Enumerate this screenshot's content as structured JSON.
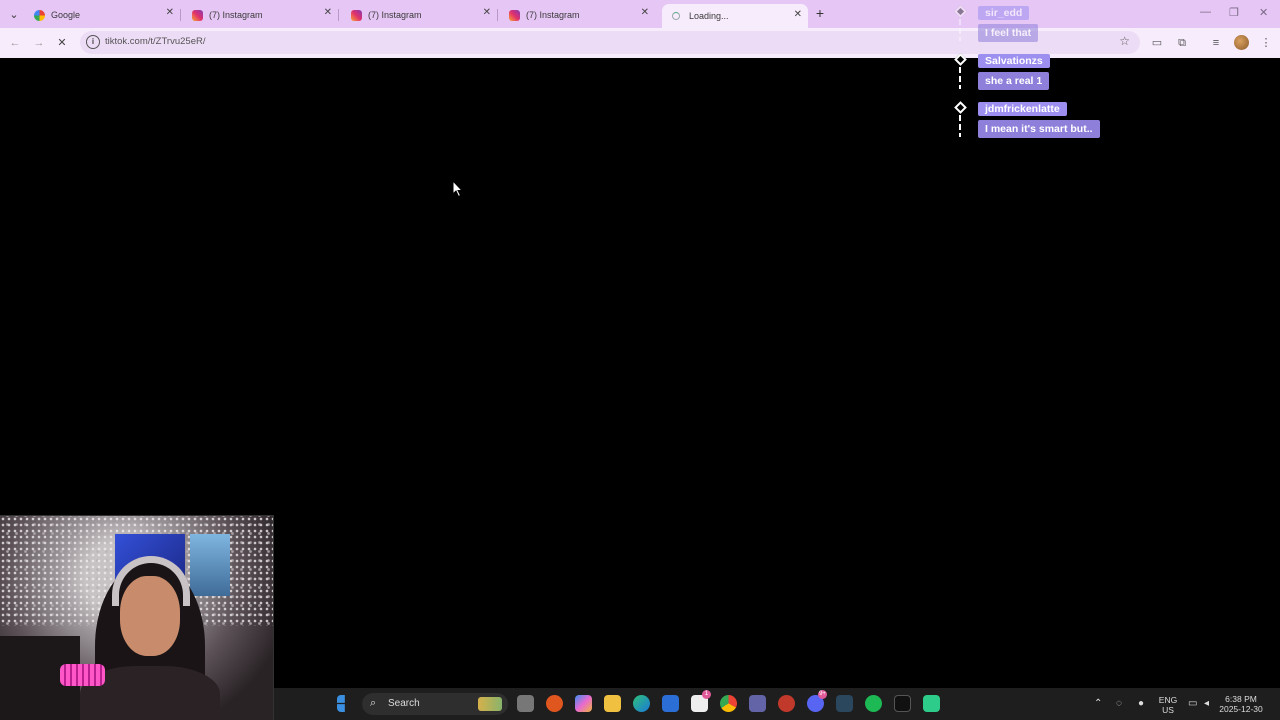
{
  "browser": {
    "tabs": [
      {
        "title": "Google",
        "favicon": "google-icon"
      },
      {
        "title": "(7) Instagram",
        "favicon": "instagram-icon"
      },
      {
        "title": "(7) Instagram",
        "favicon": "instagram-icon"
      },
      {
        "title": "(7) Instagram",
        "favicon": "instagram-icon"
      },
      {
        "title": "Loading...",
        "favicon": "loading-spinner-icon",
        "active": true
      }
    ],
    "url": "tiktok.com/t/ZTrvu25eR/",
    "accent_color": "#e6c6f5"
  },
  "chat": {
    "messages": [
      {
        "user": "sir_edd",
        "text": "I feel that"
      },
      {
        "user": "Salvationzs",
        "text": "she a real 1"
      },
      {
        "user": "jdmfrickenlatte",
        "text": "I mean it's smart but.."
      }
    ],
    "bubble_color": "#8e80da"
  },
  "taskbar": {
    "search_label": "Search",
    "language_line1": "ENG",
    "language_line2": "US",
    "time": "6:38 PM",
    "date": "2025-12-30",
    "teams_badge": "1",
    "discord_badge": "9+"
  }
}
